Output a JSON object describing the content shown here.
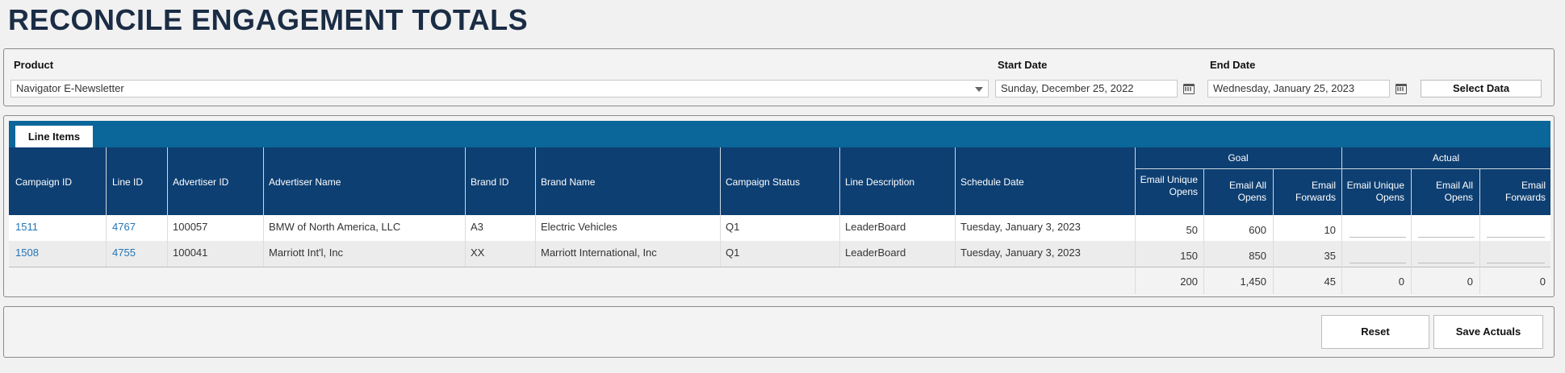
{
  "page": {
    "title": "RECONCILE ENGAGEMENT TOTALS"
  },
  "filters": {
    "product_label": "Product",
    "product_value": "Navigator E-Newsletter",
    "start_label": "Start Date",
    "start_value": "Sunday, December 25, 2022",
    "end_label": "End Date",
    "end_value": "Wednesday, January 25, 2023",
    "select_button": "Select Data"
  },
  "grid": {
    "tab_label": "Line Items",
    "group_goal": "Goal",
    "group_actual": "Actual",
    "headers": {
      "campaign_id": "Campaign ID",
      "line_id": "Line ID",
      "advertiser_id": "Advertiser ID",
      "advertiser_name": "Advertiser Name",
      "brand_id": "Brand ID",
      "brand_name": "Brand Name",
      "campaign_status": "Campaign Status",
      "line_description": "Line Description",
      "schedule_date": "Schedule Date",
      "goal_unique_opens": "Email Unique Opens",
      "goal_all_opens": "Email All Opens",
      "goal_forwards": "Email Forwards",
      "actual_unique_opens": "Email Unique Opens",
      "actual_all_opens": "Email All Opens",
      "actual_forwards": "Email Forwards"
    },
    "rows": [
      {
        "campaign_id": "1511",
        "line_id": "4767",
        "advertiser_id": "100057",
        "advertiser_name": "BMW of North America, LLC",
        "brand_id": "A3",
        "brand_name": "Electric Vehicles",
        "campaign_status": "Q1",
        "line_description": "LeaderBoard",
        "schedule_date": "Tuesday, January 3, 2023",
        "goal_unique_opens": "50",
        "goal_all_opens": "600",
        "goal_forwards": "10"
      },
      {
        "campaign_id": "1508",
        "line_id": "4755",
        "advertiser_id": "100041",
        "advertiser_name": "Marriott Int'l, Inc",
        "brand_id": "XX",
        "brand_name": "Marriott International, Inc",
        "campaign_status": "Q1",
        "line_description": "LeaderBoard",
        "schedule_date": "Tuesday, January 3, 2023",
        "goal_unique_opens": "150",
        "goal_all_opens": "850",
        "goal_forwards": "35"
      }
    ],
    "totals": {
      "goal_unique_opens": "200",
      "goal_all_opens": "1,450",
      "goal_forwards": "45",
      "actual_unique_opens": "0",
      "actual_all_opens": "0",
      "actual_forwards": "0"
    }
  },
  "actions": {
    "reset": "Reset",
    "save": "Save Actuals"
  },
  "colors": {
    "tab_strip": "#0b6699",
    "header": "#0d3f72",
    "link": "#2474b5",
    "title": "#1b2d45"
  },
  "icons": {
    "product_dropdown": "chevron-down-icon",
    "date_picker": "calendar-icon"
  }
}
